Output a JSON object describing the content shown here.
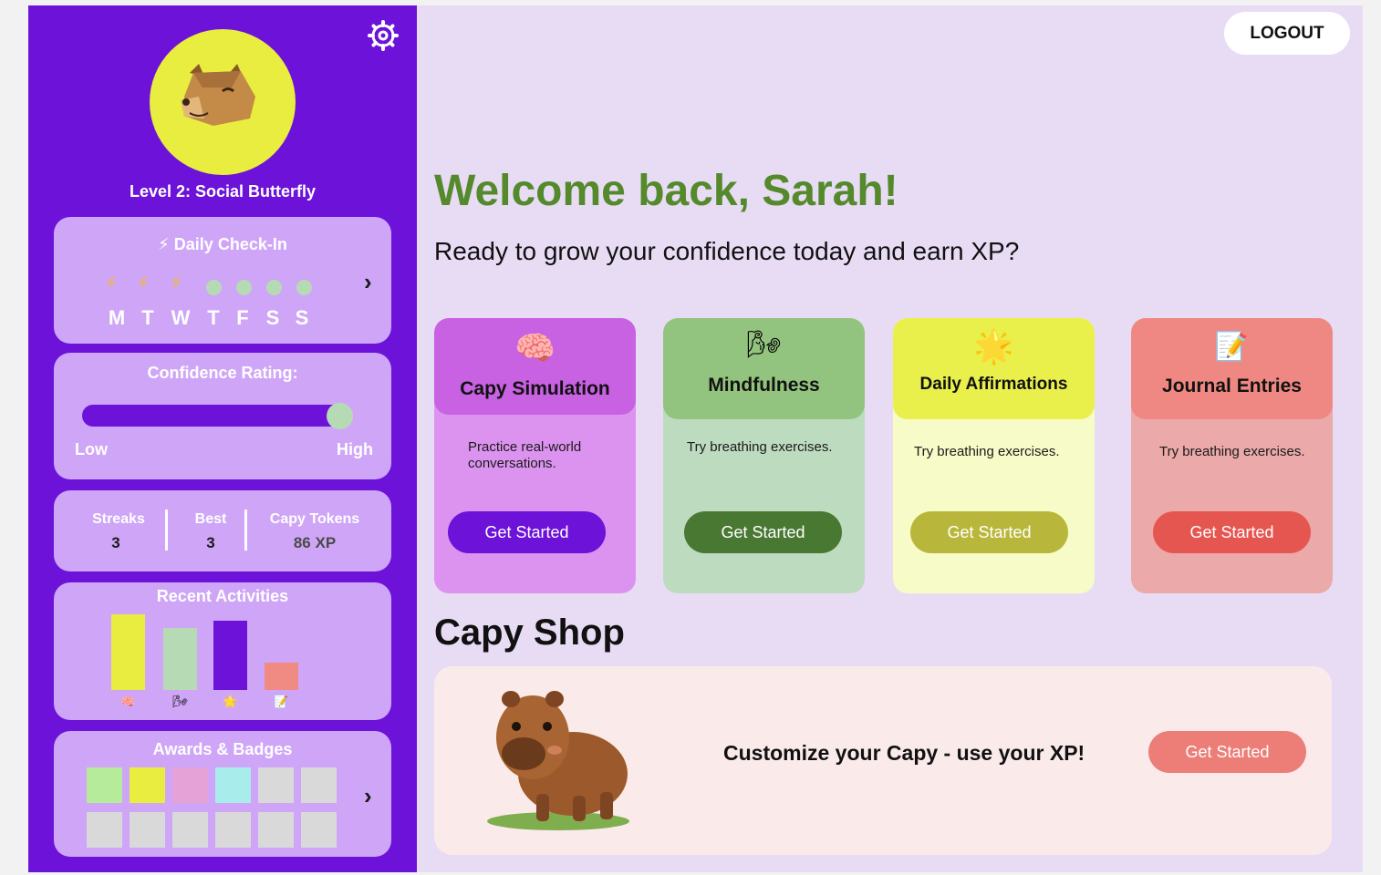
{
  "sidebar": {
    "level": "Level 2: Social Butterfly",
    "checkin": {
      "title": "⚡ Daily Check-In",
      "days": [
        "M",
        "T",
        "W",
        "T",
        "F",
        "S",
        "S"
      ],
      "completed": [
        true,
        true,
        true,
        false,
        false,
        false,
        false
      ]
    },
    "confidence": {
      "title": "Confidence Rating:",
      "low": "Low",
      "high": "High",
      "level": 1.0
    },
    "stats": {
      "streaks_label": "Streaks",
      "streaks_value": "3",
      "best_label": "Best",
      "best_value": "3",
      "tokens_label": "Capy Tokens",
      "tokens_value": "86 XP"
    },
    "recent": {
      "title": "Recent Activities",
      "values": [
        1.0,
        0.82,
        0.92,
        0.36
      ],
      "colors": [
        "#e8ed40",
        "#b6dbb4",
        "#6c12d9",
        "#ef8b82"
      ],
      "icons": [
        "brain-icon",
        "mindfulness-icon",
        "star-icon",
        "memo-icon"
      ]
    },
    "awards": {
      "title": "Awards & Badges",
      "badge_colors": [
        "#b6eb9b",
        "#e8ed40",
        "#e4a2d6",
        "#a9ecec",
        "#d9d9d9",
        "#d9d9d9",
        "#d9d9d9",
        "#d9d9d9",
        "#d9d9d9",
        "#d9d9d9",
        "#d9d9d9",
        "#d9d9d9"
      ]
    }
  },
  "header": {
    "logout": "LOGOUT"
  },
  "main": {
    "welcome": "Welcome back, Sarah!",
    "subtitle": "Ready to grow your confidence today and earn XP?",
    "activities": [
      {
        "title": "Capy Simulation",
        "desc": "Practice real-world conversations.",
        "button": "Get Started",
        "icon": "brain-icon"
      },
      {
        "title": "Mindfulness",
        "desc": "Try breathing exercises.",
        "button": "Get Started",
        "icon": "mindfulness-icon"
      },
      {
        "title": "Daily Affirmations",
        "desc": "Try breathing exercises.",
        "button": "Get Started",
        "icon": "star-icon"
      },
      {
        "title": "Journal Entries",
        "desc": "Try breathing exercises.",
        "button": "Get Started",
        "icon": "memo-icon"
      }
    ],
    "shop": {
      "title": "Capy Shop",
      "text": "Customize your Capy - use your XP!",
      "button": "Get Started"
    }
  },
  "colors": {
    "sidebar": "#6c12d9",
    "card": "#cfa6f7",
    "main_bg": "#e8dcf5",
    "welcome": "#548a2c"
  }
}
